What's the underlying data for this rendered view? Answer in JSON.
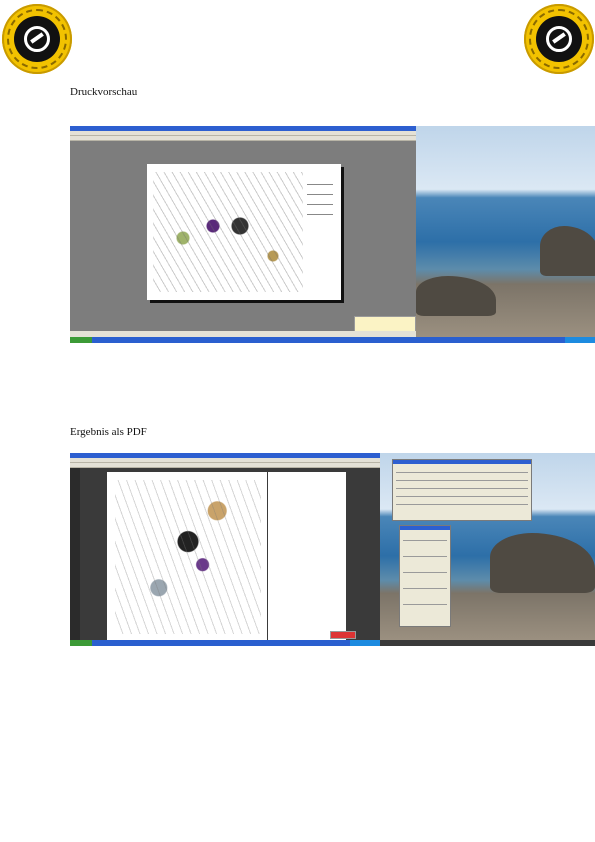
{
  "stamp_text": "PDF-XChange Click to buy NOW! www.docu-track.com",
  "sections": [
    {
      "heading": "Druckvorschau"
    },
    {
      "heading": "Ergebnis als PDF"
    }
  ],
  "colors": {
    "taskbar": "#2a5fcf",
    "sea": "#2d6fa8",
    "stamp": "#f2c200",
    "dark_bg": "#3a3a3a"
  },
  "icons": [
    "pdf-xchange-stamp-icon"
  ]
}
